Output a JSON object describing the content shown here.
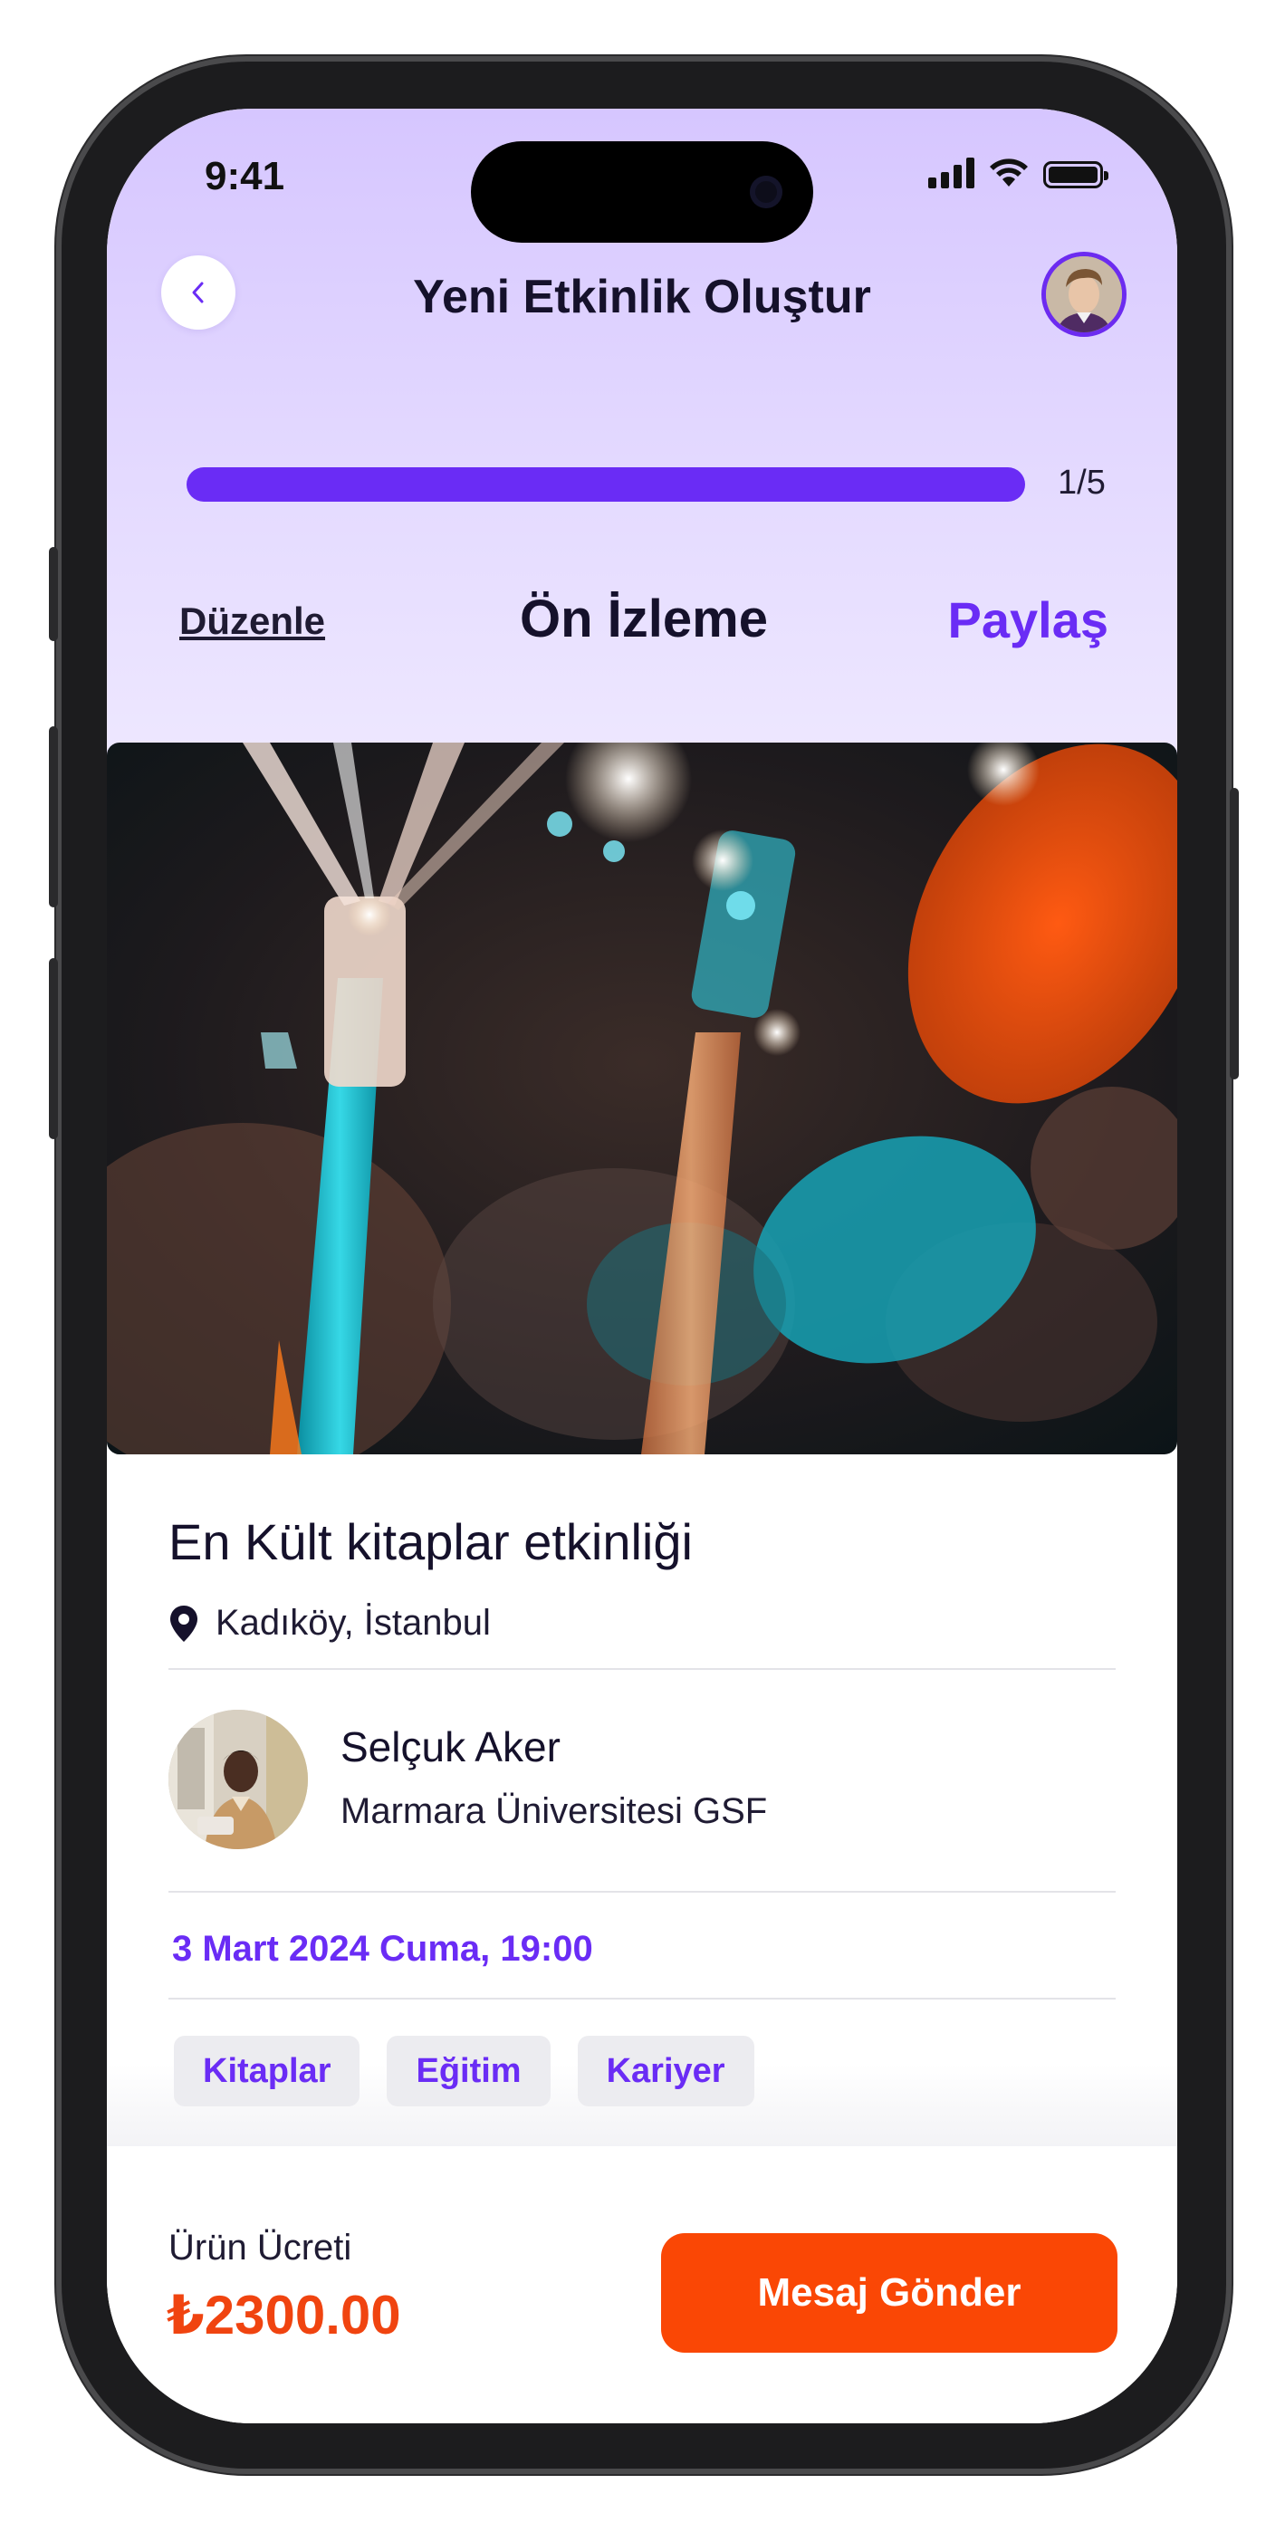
{
  "status_bar": {
    "time": "9:41",
    "icons": [
      "signal-icon",
      "wifi-icon",
      "battery-icon"
    ]
  },
  "header": {
    "title": "Yeni Etkinlik Oluştur",
    "back_icon": "chevron-left-icon",
    "profile_avatar": "user-avatar"
  },
  "progress": {
    "label": "1/5",
    "fraction": 1.0
  },
  "actions": {
    "edit": "Düzenle",
    "title": "Ön İzleme",
    "share": "Paylaş"
  },
  "event": {
    "name": "En Kült kitaplar etkinliği",
    "location": "Kadıköy, İstanbul",
    "date": "3 Mart 2024 Cuma, 19:00",
    "organizer": {
      "name": "Selçuk Aker",
      "organization": "Marmara Üniversitesi GSF"
    },
    "tags": [
      "Kitaplar",
      "Eğitim",
      "Kariyer"
    ]
  },
  "footer": {
    "price_label": "Ürün Ücreti",
    "price": "₺2300.00",
    "message_button": "Mesaj Gönder"
  },
  "colors": {
    "accent": "#6a2cf5",
    "cta": "#fa4705",
    "price": "#f04410",
    "header_gradient_top": "#d6c6ff"
  }
}
